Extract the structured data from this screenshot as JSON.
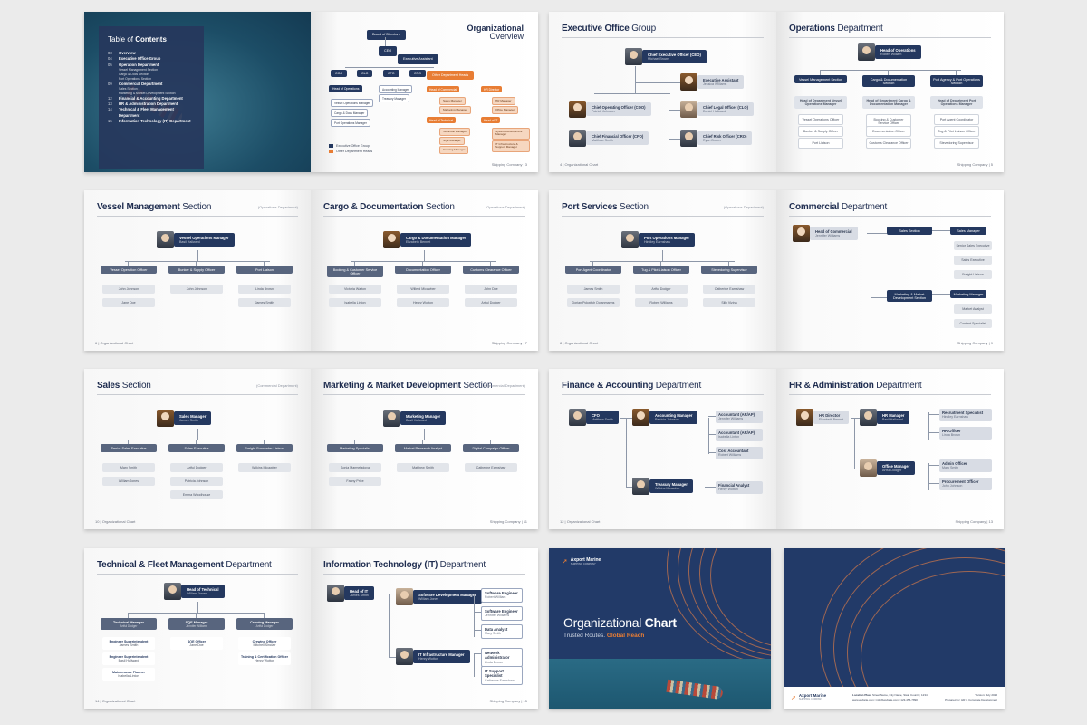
{
  "toc": {
    "title_light": "Table of ",
    "title_bold": "Contents",
    "items": [
      {
        "num": "03",
        "label": "Overview"
      },
      {
        "num": "04",
        "label": "Executive Office Group"
      },
      {
        "num": "05",
        "label": "Operation Department"
      },
      {
        "num": "",
        "label": "Vessel Management Section",
        "sub": true
      },
      {
        "num": "",
        "label": "Cargo & Docs Section",
        "sub": true
      },
      {
        "num": "",
        "label": "Port Operations Section",
        "sub": true
      },
      {
        "num": "09",
        "label": "Commercial Department"
      },
      {
        "num": "",
        "label": "Sales Section",
        "sub": true
      },
      {
        "num": "",
        "label": "Marketing & Market Development Section",
        "sub": true
      },
      {
        "num": "12",
        "label": "Financial & Accounting Department"
      },
      {
        "num": "13",
        "label": "HR & Administration Department"
      },
      {
        "num": "14",
        "label": "Technical & Fleet Management Department"
      },
      {
        "num": "15",
        "label": "Information Technology (IT) Department"
      }
    ]
  },
  "overview": {
    "title_bold": "Organizational",
    "title_light": "Overview",
    "top": "Board of Directors",
    "ceo": "CEO",
    "assistant": "Executive Assistant",
    "execs": [
      "COO",
      "CLO",
      "CFO",
      "CRO"
    ],
    "other_heads": "Other Department Heads",
    "left_col_head": "Head of Operations",
    "left_col": [
      "Vessel Operations Manager",
      "Cargo & Docs Manager",
      "Port Operations Manager"
    ],
    "mid_col": [
      "Accounting Manager",
      "Treasury Manager"
    ],
    "commercial": "Head of Commercial",
    "commercial_items": [
      "Sales Manager",
      "Marketing Manager"
    ],
    "hr": "HR Director",
    "hr_items": [
      "HR Manager",
      "Office Manager"
    ],
    "technical": "Head of Technical",
    "technical_items": [
      "Technical Manager",
      "SQE Manager",
      "Crewing Manager"
    ],
    "it": "Head of IT",
    "it_items": [
      "System Development Manager",
      "IT Infrastructure & Support Manager"
    ],
    "legend_a": "Executive Office Group",
    "legend_b": "Other Department Heads",
    "footer": "Shipping Company | 3"
  },
  "exec": {
    "title_bold": "Executive Office",
    "title_light": " Group",
    "ceo": {
      "role": "Chief Executive Officer (CEO)",
      "name": "Michael Brown"
    },
    "assistant": {
      "role": "Executive Assistant",
      "name": "Jessica Williams"
    },
    "left": [
      {
        "role": "Chief Operating Officer (COO)",
        "name": "Patrick Johnson"
      },
      {
        "role": "Chief Financial Officer (CFO)",
        "name": "Matthew Smith"
      }
    ],
    "right": [
      {
        "role": "Chief Legal Officer (CLO)",
        "name": "Daniel Hallward"
      },
      {
        "role": "Chief Risk Officer (CRO)",
        "name": "Ryan Brown"
      }
    ],
    "footer": "4 | Organizational Chart"
  },
  "ops": {
    "title_bold": "Operations",
    "title_light": " Department",
    "head": {
      "role": "Head of Operations",
      "name": "Robert William"
    },
    "cols": [
      {
        "head": "Vessel Management Section",
        "mgr": "Head of Department Vessel Operations Manager",
        "items": [
          "Vessel Operations Officer",
          "Bunker & Supply Officer",
          "Port Liaison"
        ]
      },
      {
        "head": "Cargo & Documentation Section",
        "mgr": "Head of Department Cargo & Documentation Manager",
        "items": [
          "Booking & Customer Service Officer",
          "Documentation Officer",
          "Customs Clearance Officer"
        ]
      },
      {
        "head": "Port Agency & Port Operations Section",
        "mgr": "Head of Department Port Operations Manager",
        "items": [
          "Port Agent Coordinator",
          "Tug & Pilot Liaison Officer",
          "Stevedoring Supervisor"
        ]
      }
    ],
    "footer": "Shipping Company | 5"
  },
  "vessel": {
    "title_bold": "Vessel Management",
    "title_light": " Section",
    "tag": "(Operations Department)",
    "mgr": {
      "role": "Vessel Operations Manager",
      "name": "Basil Hallward"
    },
    "cols": [
      {
        "head": "Vessel Operation Officer",
        "items": [
          "John Johnson",
          "Jane Doe"
        ]
      },
      {
        "head": "Bunker & Supply Officer",
        "items": [
          "John Johnson"
        ]
      },
      {
        "head": "Port Liaison",
        "items": [
          "Linda Brown",
          "James Smith"
        ]
      }
    ],
    "footer": "6 | Organizational Chart"
  },
  "cargo": {
    "title_bold": "Cargo & Documentation",
    "title_light": " Section",
    "tag": "(Operations Department)",
    "mgr": {
      "role": "Cargo & Documentation Manager",
      "name": "Elizabeth Bennet"
    },
    "cols": [
      {
        "head": "Booking & Customer Service Officer",
        "items": [
          "Victoria Walton",
          "Isabella Linton"
        ]
      },
      {
        "head": "Documentation Officer",
        "items": [
          "Willerd Micawber",
          "Henry Wotton"
        ]
      },
      {
        "head": "Customs Clearance Officer",
        "items": [
          "John Doe",
          "Artful Dodger"
        ]
      }
    ],
    "footer": "Shipping Company | 7"
  },
  "port": {
    "title_bold": "Port Services",
    "title_light": " Section",
    "tag": "(Operations Department)",
    "mgr": {
      "role": "Port Operations Manager",
      "name": "Hindley Earnshaw"
    },
    "cols": [
      {
        "head": "Port Agent Coordinator",
        "items": [
          "James Smith",
          "Dorian Pckwitch Dolanmanns"
        ]
      },
      {
        "head": "Tug & Pilot Liaison Officer",
        "items": [
          "Artful Dodger",
          "Robert Williams"
        ]
      },
      {
        "head": "Stevedoring Supervisor",
        "items": [
          "Catherine Earnshaw",
          "Silly Vizina"
        ]
      }
    ],
    "footer": "8 | Organizational Chart"
  },
  "commercial": {
    "title_bold": "Commercial",
    "title_light": " Department",
    "head": {
      "role": "Head of Commercial",
      "name": "Jennifer Williams"
    },
    "sales": "Sales Section",
    "sales_mgr": "Sales Manager",
    "sales_items": [
      "Senior Sales Executive",
      "Sales Executive",
      "Freight Liaison"
    ],
    "mkt": "Marketing & Market Development Section",
    "mkt_mgr": "Marketing Manager",
    "mkt_items": [
      "Market Analyst",
      "Content Specialist"
    ],
    "footer": "Shipping Company | 9"
  },
  "sales": {
    "title_bold": "Sales",
    "title_light": " Section",
    "tag": "(Commercial Department)",
    "mgr": {
      "role": "Sales Manager",
      "name": "James Smith"
    },
    "cols": [
      {
        "head": "Senior Sales Executive",
        "items": [
          "Mary Smith",
          "William Jones"
        ]
      },
      {
        "head": "Sales Executive",
        "items": [
          "Artful Dodger",
          "Patricia Johnson",
          "Emma Woodhouse"
        ]
      },
      {
        "head": "Freight Forwarder Liaison",
        "items": [
          "Wilkins Micawber"
        ]
      }
    ],
    "footer": "10 | Organizational Chart"
  },
  "mkt": {
    "title_bold": "Marketing & Market Development",
    "title_light": " Section",
    "tag": "(Commercial Department)",
    "mgr": {
      "role": "Marketing Manager",
      "name": "Basil Hallward"
    },
    "cols": [
      {
        "head": "Marketing Specialist",
        "items": [
          "Sonia Marmeladova",
          "Fanny Price"
        ]
      },
      {
        "head": "Market Research Analyst",
        "items": [
          "Matthew Smith"
        ]
      },
      {
        "head": "Digital Campaign Officer",
        "items": [
          "Catherine Earnshaw"
        ]
      }
    ],
    "footer": "Shipping Company | 11"
  },
  "finance": {
    "title_bold": "Finance & Accounting",
    "title_light": " Department",
    "cfo": {
      "role": "CFO",
      "name": "Matthew Smith"
    },
    "acc_mgr": {
      "role": "Accounting Manager",
      "name": "Patricia Johnson"
    },
    "acc_items": [
      {
        "role": "Accountant (AR/AP)",
        "name": "Jennifer Williams"
      },
      {
        "role": "Accountant (AR/AP)",
        "name": "Isabella Linton"
      },
      {
        "role": "Cost Accountant",
        "name": "Robert Williams"
      }
    ],
    "tre_mgr": {
      "role": "Treasury Manager",
      "name": "Wilkins Micawber"
    },
    "tre_items": [
      {
        "role": "Financial Analyst",
        "name": "Henry Wotton"
      }
    ],
    "footer": "12 | Organizational Chart"
  },
  "hr": {
    "title_bold": "HR & Administration",
    "title_light": " Department",
    "dir": {
      "role": "HR Director",
      "name": "Elizabeth Bennet"
    },
    "hr_mgr": {
      "role": "HR Manager",
      "name": "Basil Hallward"
    },
    "hr_items": [
      {
        "role": "Recruitment Specialist",
        "name": "Hindley Earnshaw"
      },
      {
        "role": "HR Officer",
        "name": "Linda Brown"
      }
    ],
    "off_mgr": {
      "role": "Office Manager",
      "name": "Artful Dodger"
    },
    "off_items": [
      {
        "role": "Admin Officer",
        "name": "Mary Smith"
      },
      {
        "role": "Procurement Officer",
        "name": "John Johnson"
      }
    ],
    "footer": "Shipping Company | 13"
  },
  "tech": {
    "title_bold": "Technical & Fleet Management",
    "title_light": " Department",
    "head": {
      "role": "Head of Technical",
      "name": "William Jones"
    },
    "cols": [
      {
        "head": "Technical Manager",
        "name": "Artful Dodger",
        "items": [
          {
            "role": "Engineer Superintendent",
            "name": "James Smith"
          },
          {
            "role": "Engineer Superintendent",
            "name": "Basil Hallward"
          },
          {
            "role": "Maintenance Planner",
            "name": "Isabella Linton"
          }
        ]
      },
      {
        "head": "SQE Manager",
        "name": "Jennifer Williams",
        "items": [
          {
            "role": "SQE Officer",
            "name": "Jane Doe"
          }
        ]
      },
      {
        "head": "Crewing Manager",
        "name": "Artful Dodger",
        "items": [
          {
            "role": "Crewing Officer",
            "name": "Mitchell Sinclair"
          },
          {
            "role": "Training & Certification Officer",
            "name": "Henry Wotton"
          }
        ]
      }
    ],
    "footer": "14 | Organizational Chart"
  },
  "it": {
    "title_bold": "Information Technology (IT)",
    "title_light": " Department",
    "head": {
      "role": "Head of IT",
      "name": "James Smith"
    },
    "dev_mgr": {
      "role": "Software Development Manager",
      "name": "William Jones"
    },
    "dev_items": [
      {
        "role": "Software Engineer",
        "name": "Robert William"
      },
      {
        "role": "Software Engineer",
        "name": "Jennifer Williams"
      },
      {
        "role": "Data Analyst",
        "name": "Mary Smith"
      }
    ],
    "inf_mgr": {
      "role": "IT Infrastructure Manager",
      "name": "Henry Wotton"
    },
    "inf_items": [
      {
        "role": "Network Administrator",
        "name": "Linda Brown"
      },
      {
        "role": "IT Support Specialist",
        "name": "Catherine Earnshaw"
      }
    ],
    "footer": "Shipping Company | 15"
  },
  "cover": {
    "brand": "Axport Marine",
    "brand_sub": "SHIPPING COMPANY",
    "title_light": "Organizational ",
    "title_bold": "Chart",
    "tag_light": "Trusted Routes. ",
    "tag_bold": "Global Reach"
  },
  "back": {
    "brand": "Axport Marine",
    "brand_sub": "SHIPPING COMPANY",
    "loc_label": "Location Place",
    "loc": "Street Name, City Name, State Country, 1234",
    "contact": "www.website.com | info@website.com | 123-456-7890",
    "version": "Version: July 2025",
    "prepared": "Prepared by: HR & Corporate Development"
  }
}
